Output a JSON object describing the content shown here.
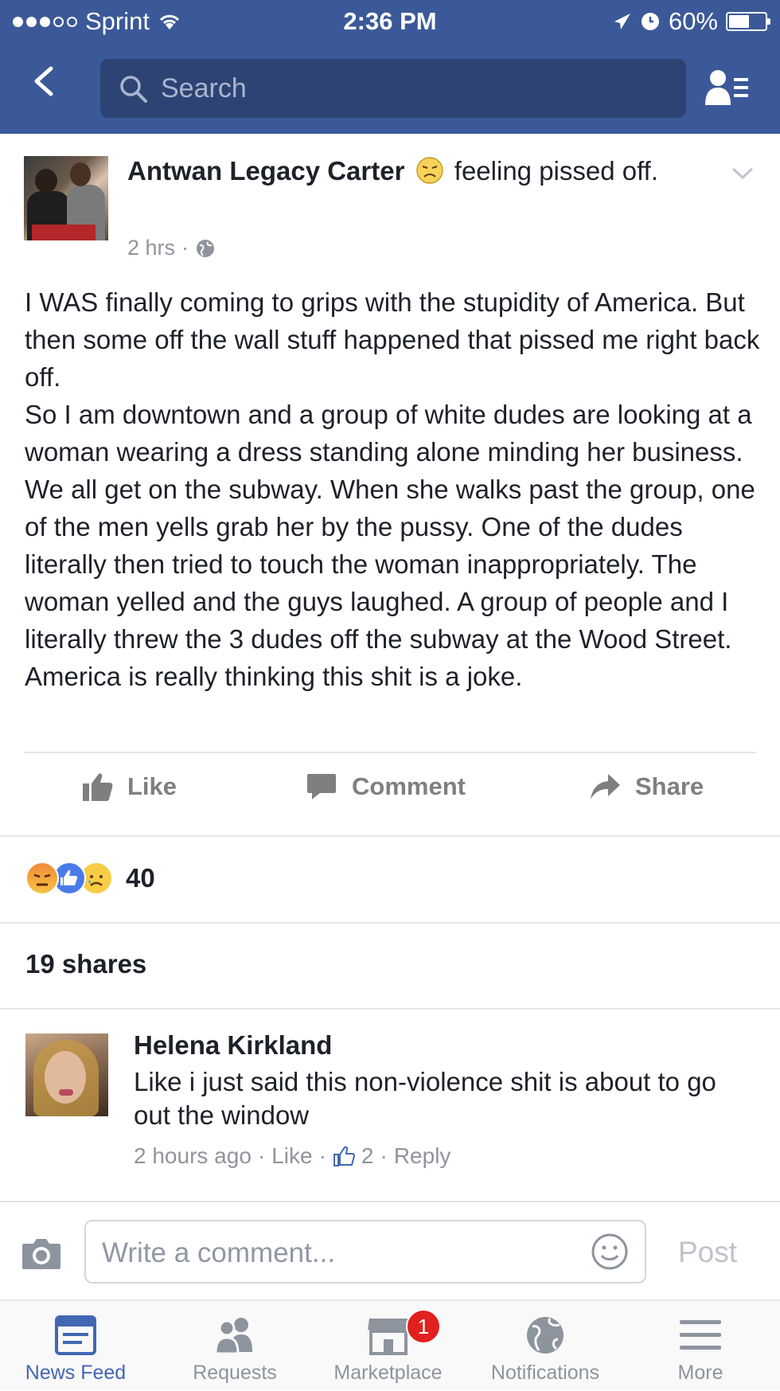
{
  "status_bar": {
    "carrier": "Sprint",
    "time": "2:36 PM",
    "battery": "60%",
    "battery_level": 0.6
  },
  "nav": {
    "search_placeholder": "Search"
  },
  "post": {
    "author": "Antwan Legacy Carter",
    "feeling": "feeling pissed off.",
    "time": "2 hrs",
    "separator": "·",
    "body": "I WAS finally coming to grips with the stupidity of America. But then some off the wall stuff happened that pissed me right back off.\nSo I am downtown and a group of white dudes are looking at a woman wearing a dress standing alone minding her business. We all get on the subway. When she walks past the group, one of the men yells grab her by the pussy. One of the dudes literally then tried to touch the woman inappropriately.  The woman yelled and the guys laughed. A group of people and I literally threw the 3 dudes off the subway at the Wood Street. America is really thinking this shit is a joke."
  },
  "actions": {
    "like": "Like",
    "comment": "Comment",
    "share": "Share"
  },
  "reactions": {
    "types": [
      "angry",
      "like",
      "sad"
    ],
    "count": "40"
  },
  "shares": "19 shares",
  "comment": {
    "author": "Helena Kirkland",
    "text": "Like i just said this non-violence shit is about to go out the window",
    "time": "2 hours ago",
    "like_label": "Like",
    "like_count": "2",
    "reply_label": "Reply",
    "separator": "·"
  },
  "composer": {
    "placeholder": "Write a comment...",
    "post_label": "Post"
  },
  "tabs": [
    {
      "label": "News Feed",
      "icon": "news-feed-icon",
      "active": true
    },
    {
      "label": "Requests",
      "icon": "friend-requests-icon"
    },
    {
      "label": "Marketplace",
      "icon": "marketplace-icon",
      "badge": "1"
    },
    {
      "label": "Notifications",
      "icon": "globe-icon"
    },
    {
      "label": "More",
      "icon": "menu-icon"
    }
  ],
  "colors": {
    "brand": "#3b5998",
    "link": "#4267b2",
    "badge": "#e0211f"
  }
}
